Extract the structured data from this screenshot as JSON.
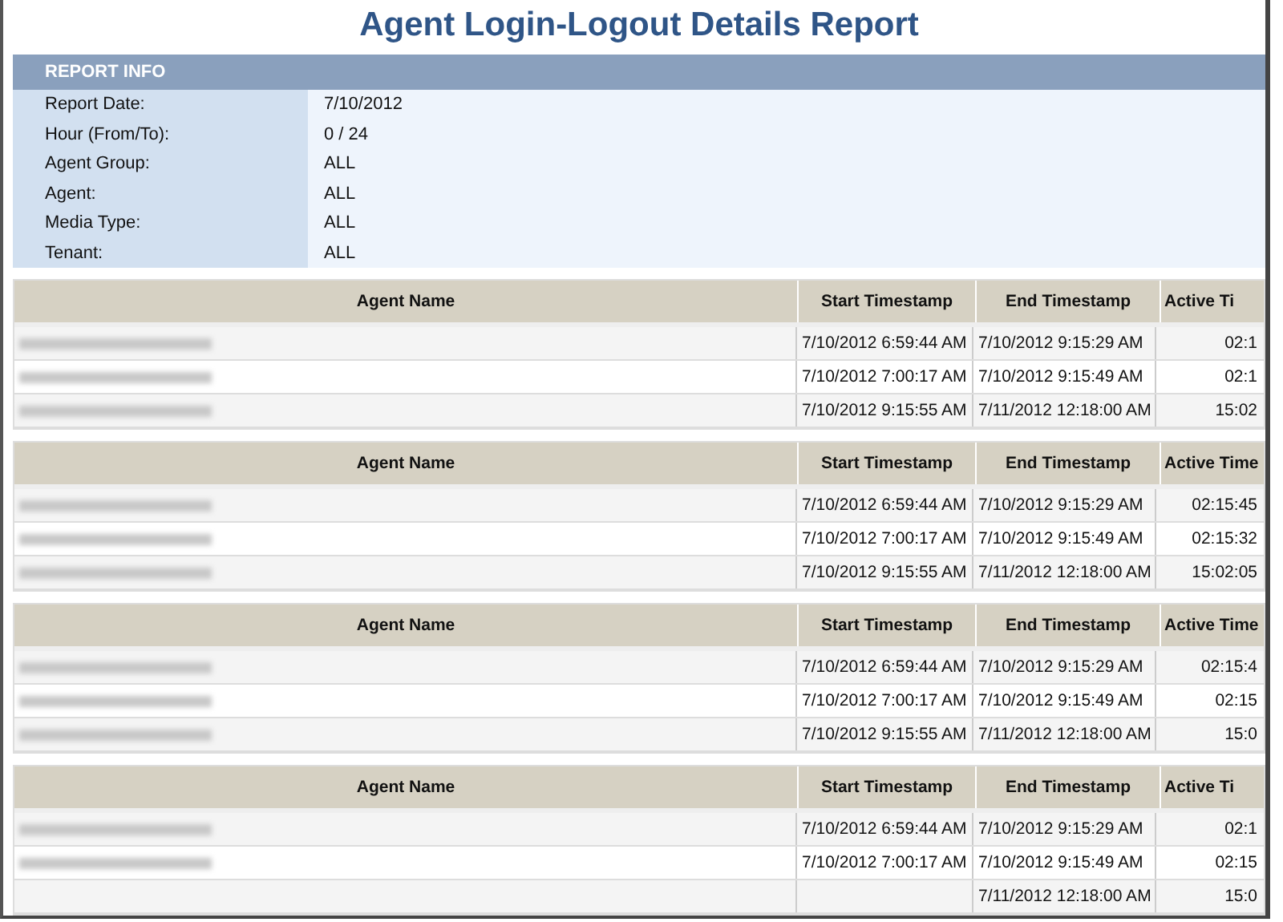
{
  "title": "Agent Login-Logout Details Report",
  "report_info": {
    "heading": "REPORT INFO",
    "fields": [
      {
        "label": "Report Date:",
        "value": "7/10/2012"
      },
      {
        "label": "Hour (From/To):",
        "value": "0 / 24"
      },
      {
        "label": "Agent Group:",
        "value": "ALL"
      },
      {
        "label": "Agent:",
        "value": "ALL"
      },
      {
        "label": "Media Type:",
        "value": "ALL"
      },
      {
        "label": "Tenant:",
        "value": "ALL"
      }
    ]
  },
  "groups": [
    {
      "columns": [
        "Agent Name",
        "Start Timestamp",
        "End Timestamp",
        "Active Ti"
      ],
      "rows": [
        {
          "start": "7/10/2012 6:59:44 AM",
          "end": "7/10/2012 9:15:29 AM",
          "active": "02:1"
        },
        {
          "start": "7/10/2012 7:00:17 AM",
          "end": "7/10/2012 9:15:49 AM",
          "active": "02:1"
        },
        {
          "start": "7/10/2012 9:15:55 AM",
          "end": "7/11/2012 12:18:00 AM",
          "active": "15:02"
        }
      ]
    },
    {
      "columns": [
        "Agent Name",
        "Start Timestamp",
        "End Timestamp",
        "Active Time"
      ],
      "rows": [
        {
          "start": "7/10/2012 6:59:44 AM",
          "end": "7/10/2012 9:15:29 AM",
          "active": "02:15:45"
        },
        {
          "start": "7/10/2012 7:00:17 AM",
          "end": "7/10/2012 9:15:49 AM",
          "active": "02:15:32"
        },
        {
          "start": "7/10/2012 9:15:55 AM",
          "end": "7/11/2012 12:18:00 AM",
          "active": "15:02:05"
        }
      ]
    },
    {
      "columns": [
        "Agent Name",
        "Start Timestamp",
        "End Timestamp",
        "Active Time"
      ],
      "rows": [
        {
          "start": "7/10/2012 6:59:44 AM",
          "end": "7/10/2012 9:15:29 AM",
          "active": "02:15:4"
        },
        {
          "start": "7/10/2012 7:00:17 AM",
          "end": "7/10/2012 9:15:49 AM",
          "active": "02:15"
        },
        {
          "start": "7/10/2012 9:15:55 AM",
          "end": "7/11/2012 12:18:00 AM",
          "active": "15:0"
        }
      ]
    },
    {
      "columns": [
        "Agent Name",
        "Start Timestamp",
        "End Timestamp",
        "Active Ti"
      ],
      "rows": [
        {
          "start": "7/10/2012 6:59:44 AM",
          "end": "7/10/2012 9:15:29 AM",
          "active": "02:1"
        },
        {
          "start": "7/10/2012 7:00:17 AM",
          "end": "7/10/2012 9:15:49 AM",
          "active": "02:15"
        },
        {
          "end": "7/11/2012 12:18:00 AM",
          "active": "15:0"
        }
      ]
    }
  ]
}
